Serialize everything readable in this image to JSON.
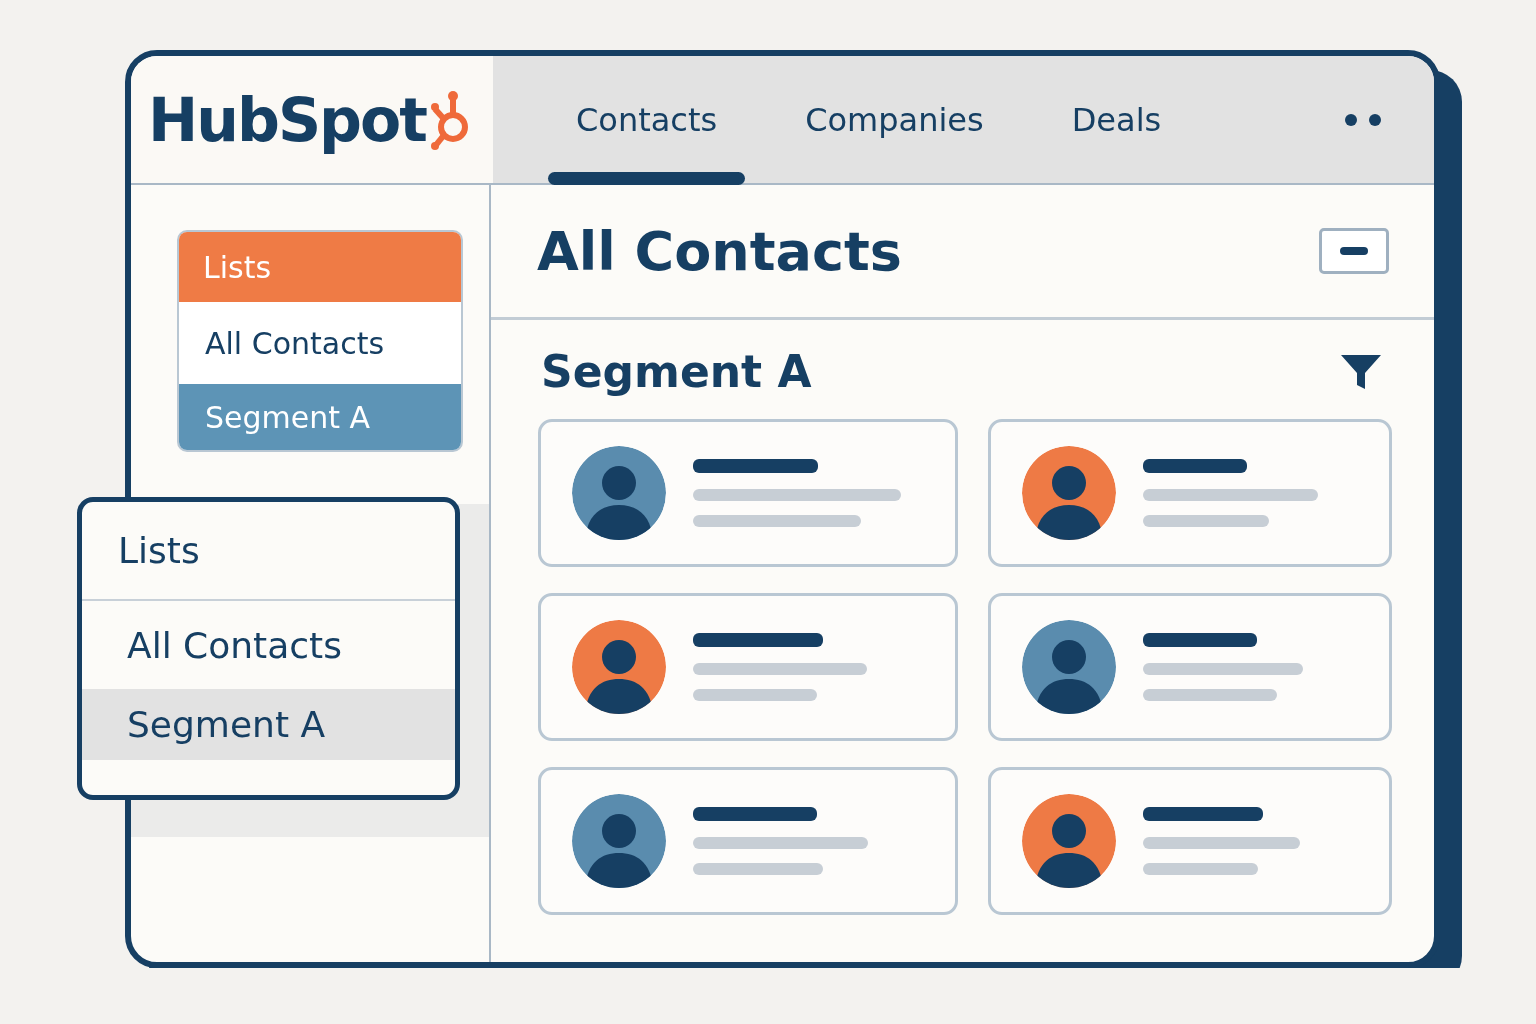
{
  "logo": {
    "text": "HubSpot"
  },
  "tabs": [
    {
      "label": "Contacts",
      "selected": true
    },
    {
      "label": "Companies",
      "selected": false
    },
    {
      "label": "Deals",
      "selected": false
    }
  ],
  "sidebar": {
    "header": "Lists",
    "items": [
      {
        "label": "All Contacts",
        "selected": false
      },
      {
        "label": "Segment A",
        "selected": true
      }
    ]
  },
  "popup": {
    "header": "Lists",
    "items": [
      {
        "label": "All Contacts",
        "selected": false
      },
      {
        "label": "Segment A",
        "selected": true
      }
    ]
  },
  "main": {
    "title": "All Contacts",
    "segment": "Segment A",
    "contacts": [
      {
        "color": "#5a8cae"
      },
      {
        "color": "#ee7a45"
      },
      {
        "color": "#ee7a45"
      },
      {
        "color": "#5a8cae"
      },
      {
        "color": "#5a8cae"
      },
      {
        "color": "#ee7a45"
      }
    ]
  }
}
